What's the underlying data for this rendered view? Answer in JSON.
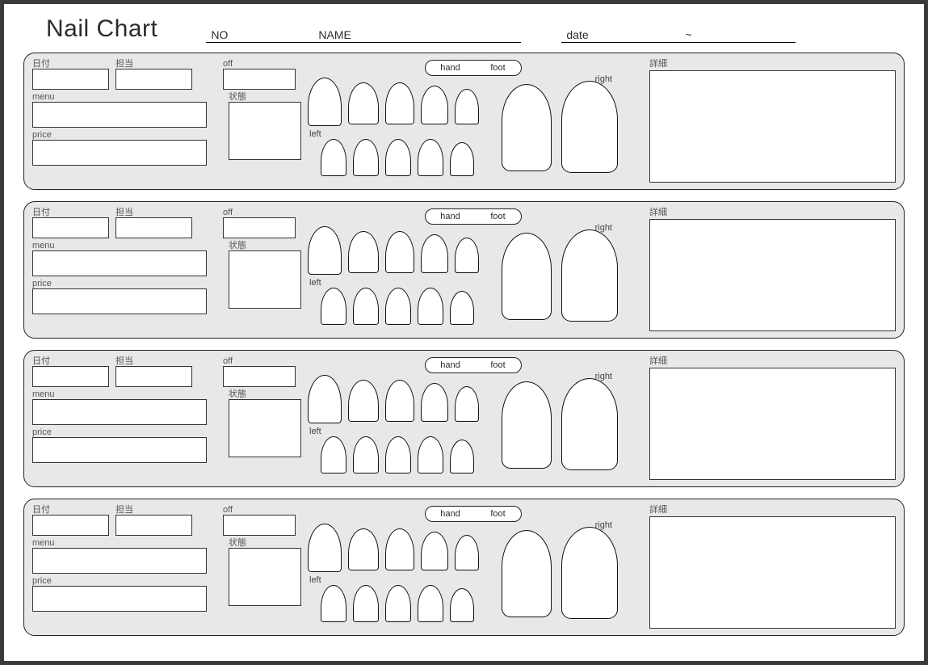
{
  "header": {
    "title": "Nail Chart",
    "no_label": "NO",
    "name_label": "NAME",
    "date_label": "date",
    "date_sep": "~"
  },
  "labels": {
    "date": "日付",
    "staff": "担当",
    "off": "off",
    "menu": "menu",
    "price": "price",
    "state": "状態",
    "hand": "hand",
    "foot": "foot",
    "right": "right",
    "left": "left",
    "detail": "詳細"
  },
  "records": [
    {
      "date": "",
      "staff": "",
      "off": "",
      "menu": "",
      "price": "",
      "state": "",
      "detail": ""
    },
    {
      "date": "",
      "staff": "",
      "off": "",
      "menu": "",
      "price": "",
      "state": "",
      "detail": ""
    },
    {
      "date": "",
      "staff": "",
      "off": "",
      "menu": "",
      "price": "",
      "state": "",
      "detail": ""
    },
    {
      "date": "",
      "staff": "",
      "off": "",
      "menu": "",
      "price": "",
      "state": "",
      "detail": ""
    }
  ]
}
